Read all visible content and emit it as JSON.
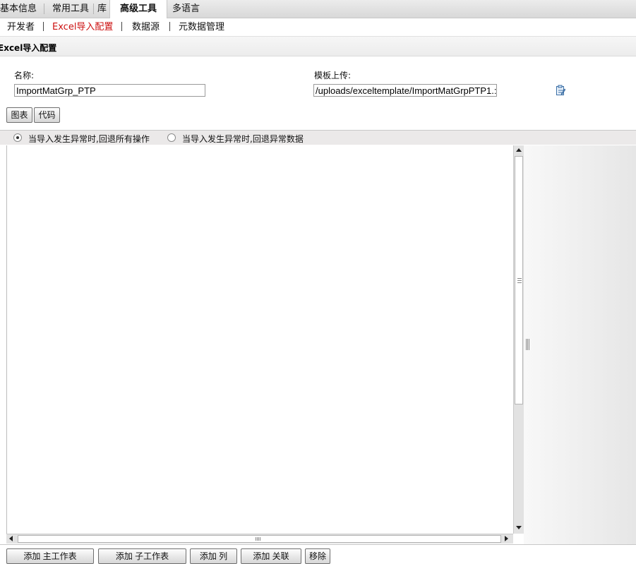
{
  "top_tabs": [
    {
      "label": "基本信息"
    },
    {
      "label": "常用工具"
    },
    {
      "label": "库"
    },
    {
      "label": "高级工具",
      "active": true
    },
    {
      "label": "多语言"
    }
  ],
  "sub_nav": [
    {
      "label": "开发者"
    },
    {
      "label": "Excel导入配置",
      "active": true
    },
    {
      "label": "数据源"
    },
    {
      "label": "元数据管理"
    }
  ],
  "section": {
    "title": "Excel导入配置"
  },
  "form": {
    "name_label": "名称:",
    "name_value": "ImportMatGrp_PTP",
    "template_label": "模板上传:",
    "template_value": "/uploads/exceltemplate/ImportMatGrpPTP1.:",
    "upload_icon": "clipboard-edit-icon"
  },
  "view_buttons": {
    "chart": "图表",
    "code": "代码"
  },
  "radio_options": [
    {
      "label": "当导入发生异常时,回退所有操作",
      "checked": true
    },
    {
      "label": "当导入发生异常时,回退异常数据",
      "checked": false
    }
  ],
  "bottom_buttons": {
    "add_main_sheet": "添加 主工作表",
    "add_sub_sheet": "添加 子工作表",
    "add_column": "添加 列",
    "add_relation": "添加 关联",
    "remove": "移除"
  },
  "colors": {
    "active_subnav": "#cc1111",
    "radio_bar": "#ebe9e9"
  }
}
